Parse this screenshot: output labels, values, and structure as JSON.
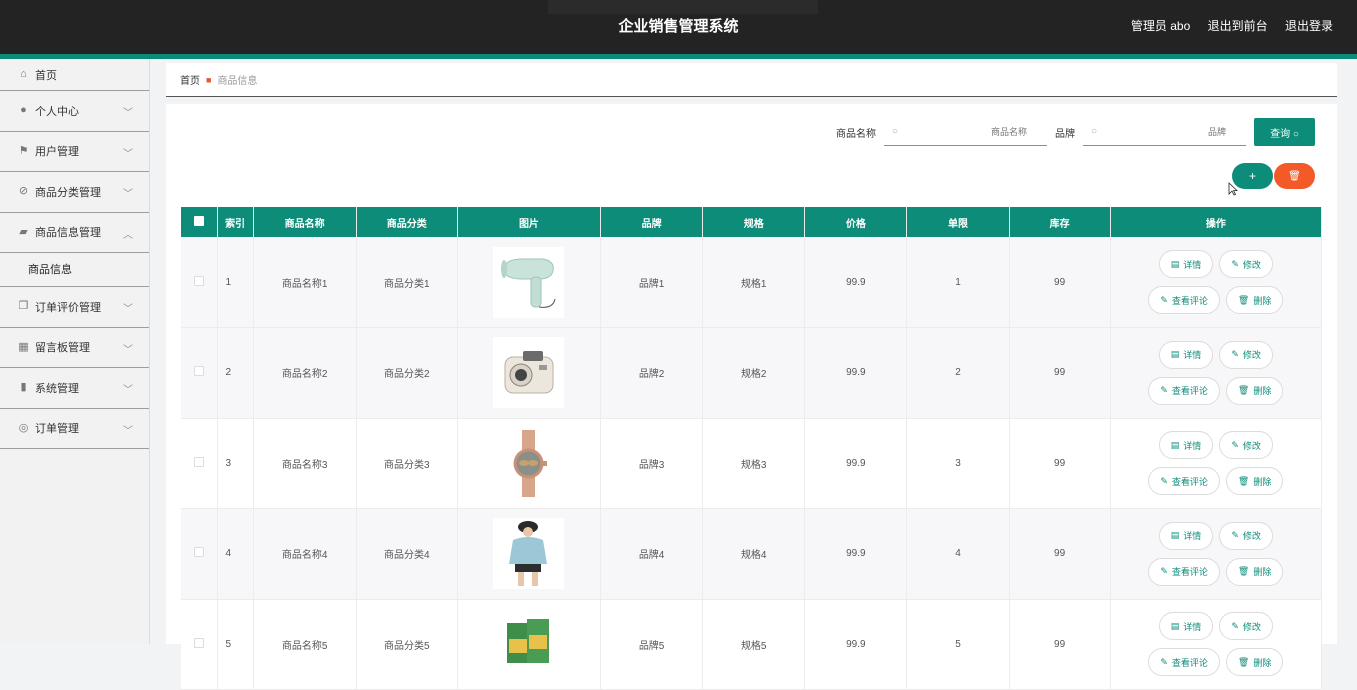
{
  "app": {
    "title": "企业销售管理系统",
    "user_label": "管理员 abo",
    "back_front": "退出到前台",
    "logout": "退出登录"
  },
  "sidebar": {
    "items": [
      {
        "label": "首页",
        "icon": "home-icon"
      },
      {
        "label": "个人中心",
        "icon": "user-icon"
      },
      {
        "label": "用户管理",
        "icon": "flag-icon"
      },
      {
        "label": "商品分类管理",
        "icon": "slash-circle-icon"
      },
      {
        "label": "商品信息管理",
        "icon": "edit-square-icon",
        "expanded": true,
        "sub": [
          "商品信息"
        ]
      },
      {
        "label": "订单评价管理",
        "icon": "copy-icon"
      },
      {
        "label": "留言板管理",
        "icon": "grid-icon"
      },
      {
        "label": "系统管理",
        "icon": "chart-icon"
      },
      {
        "label": "订单管理",
        "icon": "compass-icon"
      }
    ]
  },
  "breadcrumb": {
    "home": "首页",
    "current": "商品信息"
  },
  "search": {
    "name_label": "商品名称",
    "name_placeholder": "商品名称",
    "brand_label": "品牌",
    "brand_placeholder": "品牌",
    "button": "查询"
  },
  "toolbar": {
    "add": "+",
    "delete": "🗑"
  },
  "table": {
    "headers": [
      "索引",
      "商品名称",
      "商品分类",
      "图片",
      "品牌",
      "规格",
      "价格",
      "单限",
      "库存",
      "操作"
    ],
    "rows": [
      {
        "index": "1",
        "name": "商品名称1",
        "category": "商品分类1",
        "image": "hair-dryer",
        "brand": "品牌1",
        "spec": "规格1",
        "price": "99.9",
        "limit": "1",
        "stock": "99"
      },
      {
        "index": "2",
        "name": "商品名称2",
        "category": "商品分类2",
        "image": "instant-camera",
        "brand": "品牌2",
        "spec": "规格2",
        "price": "99.9",
        "limit": "2",
        "stock": "99"
      },
      {
        "index": "3",
        "name": "商品名称3",
        "category": "商品分类3",
        "image": "wristwatch",
        "brand": "品牌3",
        "spec": "规格3",
        "price": "99.9",
        "limit": "3",
        "stock": "99"
      },
      {
        "index": "4",
        "name": "商品名称4",
        "category": "商品分类4",
        "image": "hoodie-model",
        "brand": "品牌4",
        "spec": "规格4",
        "price": "99.9",
        "limit": "4",
        "stock": "99"
      },
      {
        "index": "5",
        "name": "商品名称5",
        "category": "商品分类5",
        "image": "snack-bags",
        "brand": "品牌5",
        "spec": "规格5",
        "price": "99.9",
        "limit": "5",
        "stock": "99"
      }
    ],
    "actions": {
      "detail": "详情",
      "edit": "修改",
      "review": "查看评论",
      "delete": "删除"
    }
  },
  "colors": {
    "topbar": "#232323",
    "accent": "#0e8c7a",
    "danger": "#f45a28"
  }
}
